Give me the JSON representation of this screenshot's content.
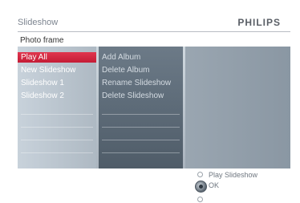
{
  "header": {
    "title": "Slideshow",
    "brand": "PHILIPS"
  },
  "breadcrumb": "Photo frame",
  "menu1": {
    "items": [
      "Play All",
      "New Slideshow",
      "Slideshow 1",
      "Slideshow 2"
    ],
    "selected_index": 0
  },
  "menu2": {
    "items": [
      "Add Album",
      "Delete Album",
      "Rename Slideshow",
      "Delete Slideshow"
    ]
  },
  "footer": {
    "up_hint": "Play Slideshow",
    "ok_hint": "OK"
  },
  "colors": {
    "selection": "#d42a44",
    "brand_text": "#5a5f66"
  }
}
